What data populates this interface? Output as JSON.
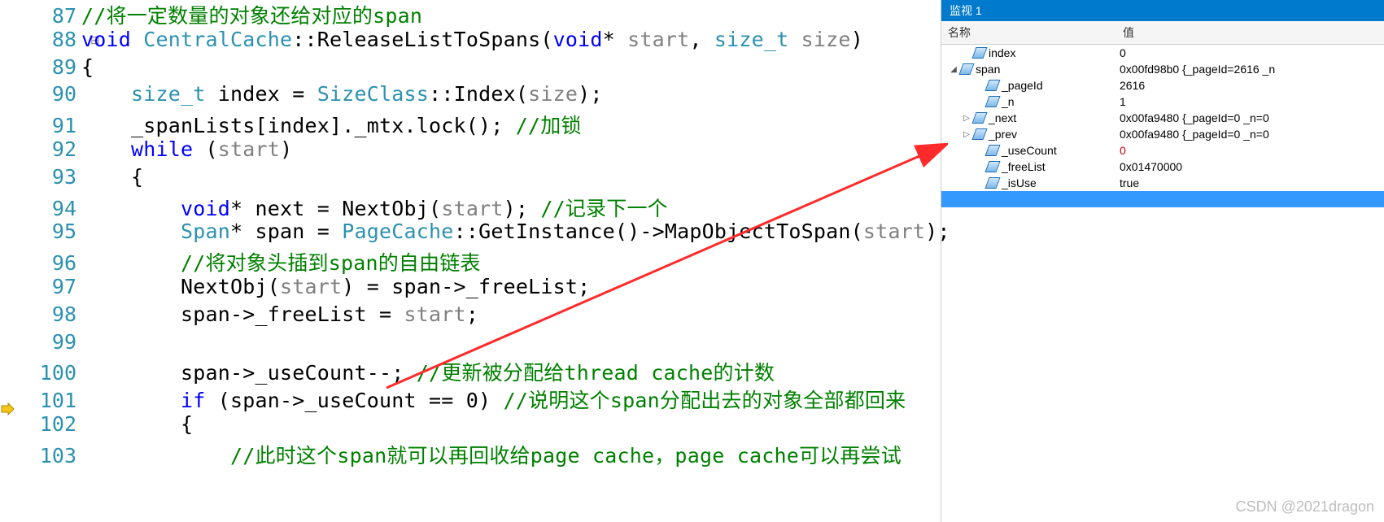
{
  "editor": {
    "collapse_glyph": "⊟",
    "breakpoint_glyph": "exec-pointer",
    "lines": [
      {
        "num": "87",
        "segments": [
          {
            "cls": "c-comment",
            "text": "//将一定数量的对象还给对应的span"
          }
        ]
      },
      {
        "num": "88",
        "segments": [
          {
            "cls": "c-keyword",
            "text": "void"
          },
          {
            "cls": "c-plain",
            "text": " "
          },
          {
            "cls": "c-type",
            "text": "CentralCache"
          },
          {
            "cls": "c-plain",
            "text": "::ReleaseListToSpans("
          },
          {
            "cls": "c-keyword",
            "text": "void"
          },
          {
            "cls": "c-plain",
            "text": "* "
          },
          {
            "cls": "c-param",
            "text": "start"
          },
          {
            "cls": "c-plain",
            "text": ", "
          },
          {
            "cls": "c-type",
            "text": "size_t"
          },
          {
            "cls": "c-plain",
            "text": " "
          },
          {
            "cls": "c-param",
            "text": "size"
          },
          {
            "cls": "c-plain",
            "text": ")"
          }
        ]
      },
      {
        "num": "89",
        "segments": [
          {
            "cls": "c-plain",
            "text": "{"
          }
        ]
      },
      {
        "num": "90",
        "segments": [
          {
            "cls": "c-plain",
            "text": "    "
          },
          {
            "cls": "c-type",
            "text": "size_t"
          },
          {
            "cls": "c-plain",
            "text": " index = "
          },
          {
            "cls": "c-type",
            "text": "SizeClass"
          },
          {
            "cls": "c-plain",
            "text": "::Index("
          },
          {
            "cls": "c-param",
            "text": "size"
          },
          {
            "cls": "c-plain",
            "text": ");"
          }
        ]
      },
      {
        "num": "91",
        "segments": [
          {
            "cls": "c-plain",
            "text": "    _spanLists[index]._mtx.lock(); "
          },
          {
            "cls": "c-comment",
            "text": "//加锁"
          }
        ]
      },
      {
        "num": "92",
        "segments": [
          {
            "cls": "c-plain",
            "text": "    "
          },
          {
            "cls": "c-keyword",
            "text": "while"
          },
          {
            "cls": "c-plain",
            "text": " ("
          },
          {
            "cls": "c-param",
            "text": "start"
          },
          {
            "cls": "c-plain",
            "text": ")"
          }
        ]
      },
      {
        "num": "93",
        "segments": [
          {
            "cls": "c-plain",
            "text": "    {"
          }
        ]
      },
      {
        "num": "94",
        "segments": [
          {
            "cls": "c-plain",
            "text": "        "
          },
          {
            "cls": "c-keyword",
            "text": "void"
          },
          {
            "cls": "c-plain",
            "text": "* next = NextObj("
          },
          {
            "cls": "c-param",
            "text": "start"
          },
          {
            "cls": "c-plain",
            "text": "); "
          },
          {
            "cls": "c-comment",
            "text": "//记录下一个"
          }
        ]
      },
      {
        "num": "95",
        "segments": [
          {
            "cls": "c-plain",
            "text": "        "
          },
          {
            "cls": "c-type",
            "text": "Span"
          },
          {
            "cls": "c-plain",
            "text": "* span = "
          },
          {
            "cls": "c-type",
            "text": "PageCache"
          },
          {
            "cls": "c-plain",
            "text": "::GetInstance()->MapObjectToSpan("
          },
          {
            "cls": "c-param",
            "text": "start"
          },
          {
            "cls": "c-plain",
            "text": ");"
          }
        ]
      },
      {
        "num": "96",
        "segments": [
          {
            "cls": "c-plain",
            "text": "        "
          },
          {
            "cls": "c-comment",
            "text": "//将对象头插到span的自由链表"
          }
        ]
      },
      {
        "num": "97",
        "segments": [
          {
            "cls": "c-plain",
            "text": "        NextObj("
          },
          {
            "cls": "c-param",
            "text": "start"
          },
          {
            "cls": "c-plain",
            "text": ") = span->_freeList;"
          }
        ]
      },
      {
        "num": "98",
        "segments": [
          {
            "cls": "c-plain",
            "text": "        span->_freeList = "
          },
          {
            "cls": "c-param",
            "text": "start"
          },
          {
            "cls": "c-plain",
            "text": ";"
          }
        ]
      },
      {
        "num": "99",
        "segments": [
          {
            "cls": "c-plain",
            "text": ""
          }
        ]
      },
      {
        "num": "100",
        "segments": [
          {
            "cls": "c-plain",
            "text": "        span->_useCount--; "
          },
          {
            "cls": "c-comment",
            "text": "//更新被分配给thread cache的计数"
          }
        ]
      },
      {
        "num": "101",
        "segments": [
          {
            "cls": "c-plain",
            "text": "        "
          },
          {
            "cls": "c-keyword",
            "text": "if"
          },
          {
            "cls": "c-plain",
            "text": " (span->_useCount == 0) "
          },
          {
            "cls": "c-comment",
            "text": "//说明这个span分配出去的对象全部都回来"
          }
        ]
      },
      {
        "num": "102",
        "segments": [
          {
            "cls": "c-plain",
            "text": "        {"
          }
        ]
      },
      {
        "num": "103",
        "segments": [
          {
            "cls": "c-plain",
            "text": "            "
          },
          {
            "cls": "c-comment",
            "text": "//此时这个span就可以再回收给page cache，page cache可以再尝试"
          }
        ]
      }
    ]
  },
  "watch": {
    "title": "监视 1",
    "header_name": "名称",
    "header_value": "值",
    "rows": [
      {
        "indent": 1,
        "tri": "",
        "name": "index",
        "value": "0",
        "sel": false,
        "red": false
      },
      {
        "indent": 0,
        "tri": "◢",
        "name": "span",
        "value": "0x00fd98b0 {_pageId=2616 _n",
        "sel": false,
        "red": false
      },
      {
        "indent": 2,
        "tri": "",
        "name": "_pageId",
        "value": "2616",
        "sel": false,
        "red": false
      },
      {
        "indent": 2,
        "tri": "",
        "name": "_n",
        "value": "1",
        "sel": false,
        "red": false
      },
      {
        "indent": 1,
        "tri": "▷",
        "name": "_next",
        "value": "0x00fa9480 {_pageId=0 _n=0 ",
        "sel": false,
        "red": false
      },
      {
        "indent": 1,
        "tri": "▷",
        "name": "_prev",
        "value": "0x00fa9480 {_pageId=0 _n=0 ",
        "sel": false,
        "red": false
      },
      {
        "indent": 2,
        "tri": "",
        "name": "_useCount",
        "value": "0",
        "sel": false,
        "red": true
      },
      {
        "indent": 2,
        "tri": "",
        "name": "_freeList",
        "value": "0x01470000",
        "sel": false,
        "red": false
      },
      {
        "indent": 2,
        "tri": "",
        "name": "_isUse",
        "value": "true",
        "sel": false,
        "red": false
      },
      {
        "indent": 0,
        "tri": "",
        "name": "",
        "value": "",
        "sel": true,
        "red": false
      }
    ]
  },
  "watermark": "CSDN @2021dragon"
}
